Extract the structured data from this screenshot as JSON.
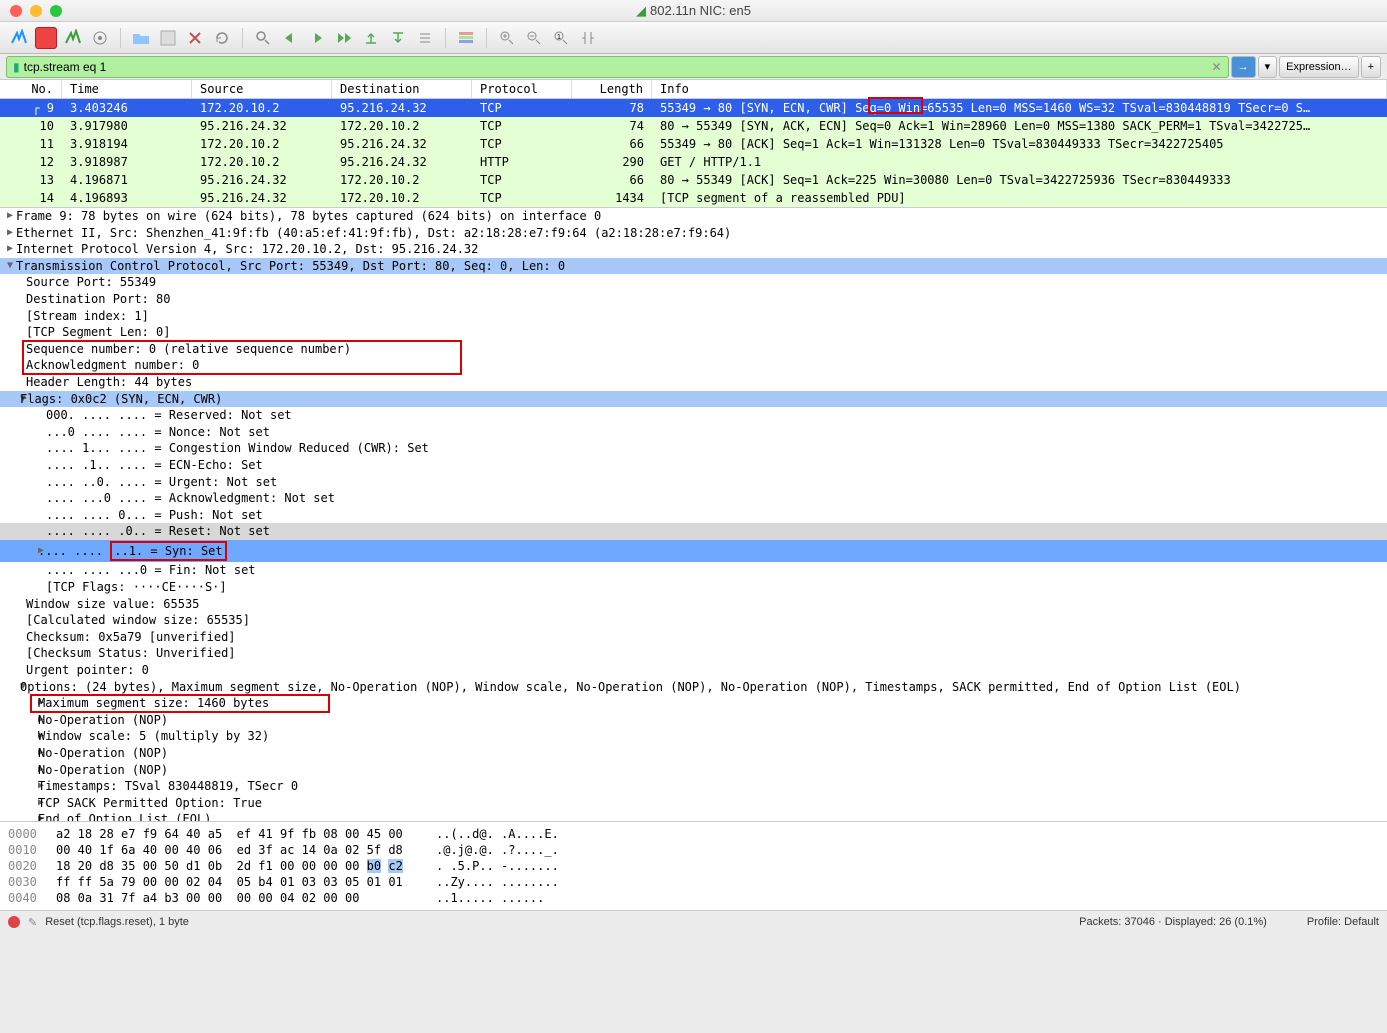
{
  "window": {
    "title": "802.11n NIC: en5"
  },
  "filter": {
    "value": "tcp.stream eq 1",
    "expression": "Expression…"
  },
  "columns": {
    "no": "No.",
    "time": "Time",
    "source": "Source",
    "destination": "Destination",
    "protocol": "Protocol",
    "length": "Length",
    "info": "Info"
  },
  "packets": [
    {
      "no": "9",
      "time": "3.403246",
      "src": "172.20.10.2",
      "dst": "95.216.24.32",
      "proto": "TCP",
      "len": "78",
      "info": "55349 → 80 [SYN, ECN, CWR] Seq=0 Win=65535 Len=0 MSS=1460 WS=32 TSval=830448819 TSecr=0 S…",
      "sel": true
    },
    {
      "no": "10",
      "time": "3.917980",
      "src": "95.216.24.32",
      "dst": "172.20.10.2",
      "proto": "TCP",
      "len": "74",
      "info": "80 → 55349 [SYN, ACK, ECN] Seq=0 Ack=1 Win=28960 Len=0 MSS=1380 SACK_PERM=1 TSval=3422725…"
    },
    {
      "no": "11",
      "time": "3.918194",
      "src": "172.20.10.2",
      "dst": "95.216.24.32",
      "proto": "TCP",
      "len": "66",
      "info": "55349 → 80 [ACK] Seq=1 Ack=1 Win=131328 Len=0 TSval=830449333 TSecr=3422725405"
    },
    {
      "no": "12",
      "time": "3.918987",
      "src": "172.20.10.2",
      "dst": "95.216.24.32",
      "proto": "HTTP",
      "len": "290",
      "info": "GET / HTTP/1.1"
    },
    {
      "no": "13",
      "time": "4.196871",
      "src": "95.216.24.32",
      "dst": "172.20.10.2",
      "proto": "TCP",
      "len": "66",
      "info": "80 → 55349 [ACK] Seq=1 Ack=225 Win=30080 Len=0 TSval=3422725936 TSecr=830449333"
    },
    {
      "no": "14",
      "time": "4.196893",
      "src": "95.216.24.32",
      "dst": "172.20.10.2",
      "proto": "TCP",
      "len": "1434",
      "info": "[TCP segment of a reassembled PDU]"
    }
  ],
  "details": {
    "frame": "Frame 9: 78 bytes on wire (624 bits), 78 bytes captured (624 bits) on interface 0",
    "eth": "Ethernet II, Src: Shenzhen_41:9f:fb (40:a5:ef:41:9f:fb), Dst: a2:18:28:e7:f9:64 (a2:18:28:e7:f9:64)",
    "ip": "Internet Protocol Version 4, Src: 172.20.10.2, Dst: 95.216.24.32",
    "tcp": "Transmission Control Protocol, Src Port: 55349, Dst Port: 80, Seq: 0, Len: 0",
    "srcport": "Source Port: 55349",
    "dstport": "Destination Port: 80",
    "stream": "[Stream index: 1]",
    "seglen": "[TCP Segment Len: 0]",
    "seq": "Sequence number: 0    (relative sequence number)",
    "ack": "Acknowledgment number: 0",
    "hlen": "Header Length: 44 bytes",
    "flags": "Flags: 0x0c2 (SYN, ECN, CWR)",
    "f_res": "000. .... .... = Reserved: Not set",
    "f_nonce": "...0 .... .... = Nonce: Not set",
    "f_cwr": ".... 1... .... = Congestion Window Reduced (CWR): Set",
    "f_ecn": ".... .1.. .... = ECN-Echo: Set",
    "f_urg": ".... ..0. .... = Urgent: Not set",
    "f_ackf": ".... ...0 .... = Acknowledgment: Not set",
    "f_push": ".... .... 0... = Push: Not set",
    "f_reset": ".... .... .0.. = Reset: Not set",
    "f_syn": ".... .... ..1. = Syn: Set",
    "f_fin": ".... .... ...0 = Fin: Not set",
    "f_str": "[TCP Flags: ····CE····S·]",
    "win": "Window size value: 65535",
    "calcwin": "[Calculated window size: 65535]",
    "chksum": "Checksum: 0x5a79 [unverified]",
    "chkstat": "[Checksum Status: Unverified]",
    "urgptr": "Urgent pointer: 0",
    "opts": "Options: (24 bytes), Maximum segment size, No-Operation (NOP), Window scale, No-Operation (NOP), No-Operation (NOP), Timestamps, SACK permitted, End of Option List (EOL)",
    "o_mss": "Maximum segment size: 1460 bytes",
    "o_nop1": "No-Operation (NOP)",
    "o_ws": "Window scale: 5 (multiply by 32)",
    "o_nop2": "No-Operation (NOP)",
    "o_nop3": "No-Operation (NOP)",
    "o_ts": "Timestamps: TSval 830448819, TSecr 0",
    "o_sack": "TCP SACK Permitted Option: True",
    "o_eol": "End of Option List (EOL)"
  },
  "hex": [
    {
      "off": "0000",
      "hex": "a2 18 28 e7 f9 64 40 a5  ef 41 9f fb 08 00 45 00",
      "asc": "..(..d@. .A....E."
    },
    {
      "off": "0010",
      "hex": "00 40 1f 6a 40 00 40 06  ed 3f ac 14 0a 02 5f d8",
      "asc": ".@.j@.@. .?...._."
    },
    {
      "off": "0020",
      "hex": "18 20 d8 35 00 50 d1 0b  2d f1 00 00 00 00 b0 c2",
      "asc": ". .5.P.. -.......",
      "hl": [
        14,
        15
      ]
    },
    {
      "off": "0030",
      "hex": "ff ff 5a 79 00 00 02 04  05 b4 01 03 03 05 01 01",
      "asc": "..Zy.... ........"
    },
    {
      "off": "0040",
      "hex": "08 0a 31 7f a4 b3 00 00  00 00 04 02 00 00",
      "asc": "..1..... ......"
    }
  ],
  "status": {
    "left": "Reset (tcp.flags.reset), 1 byte",
    "pkts": "Packets: 37046 · Displayed: 26 (0.1%)",
    "profile": "Profile: Default"
  }
}
